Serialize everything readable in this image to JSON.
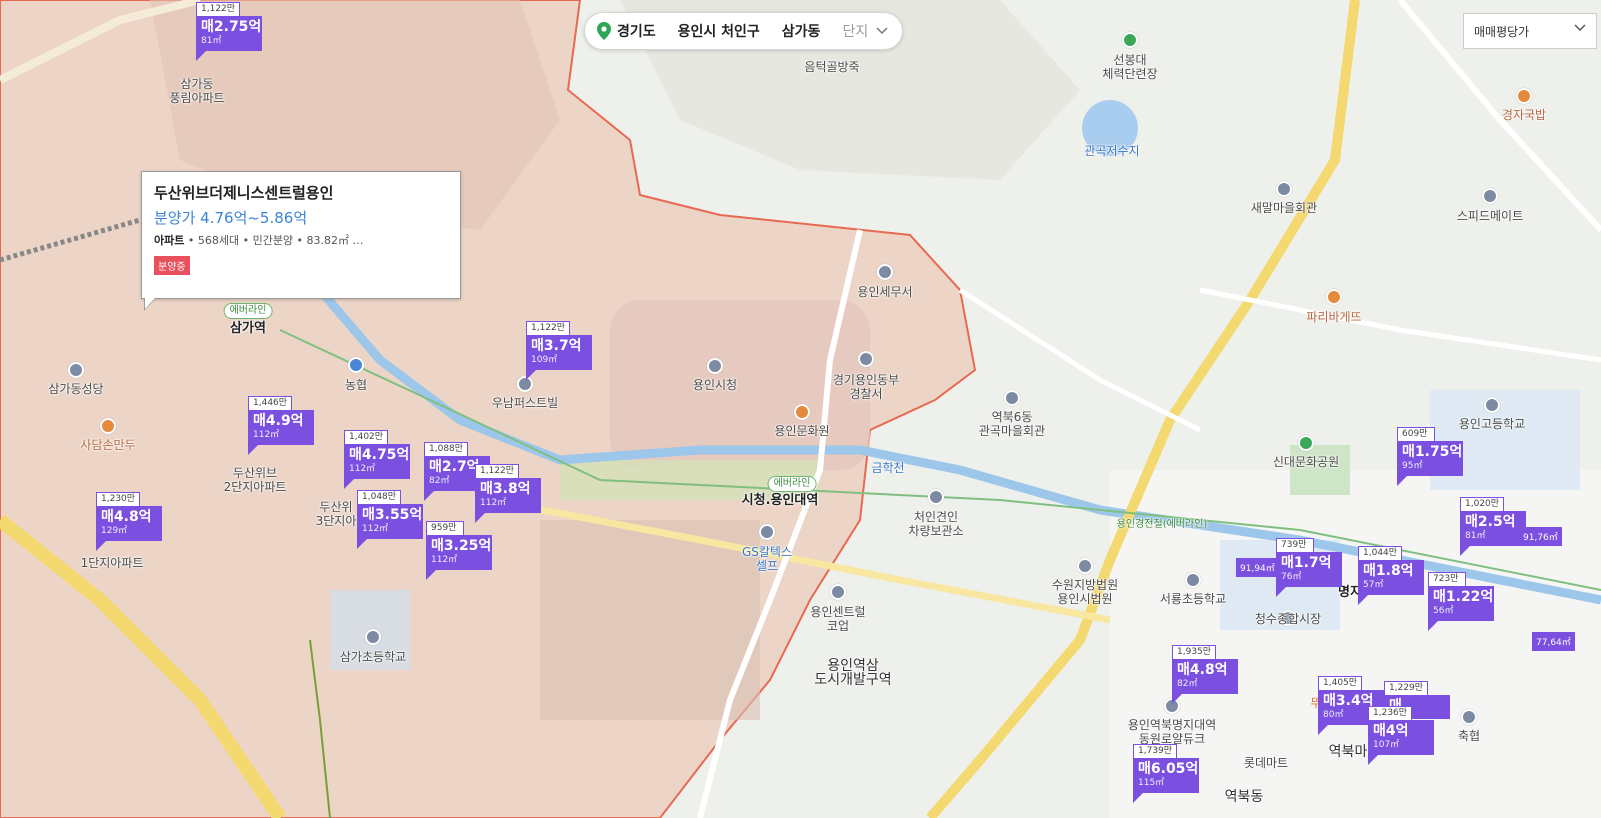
{
  "breadcrumb": {
    "province": "경기도",
    "city": "용인시 처인구",
    "dong": "삼가동",
    "complex_placeholder": "단지"
  },
  "price_type": {
    "selected": "매매평당가"
  },
  "popup": {
    "name": "두산위브더제니스센트럴용인",
    "price": "분양가 4.76억~5.86억",
    "type": "아파트",
    "details": "• 568세대 • 민간분양 • 83.82㎡ …",
    "badge": "분양중"
  },
  "markers": [
    {
      "unit": "1,122만",
      "price": "매2.75억",
      "area": "81㎡"
    },
    {
      "unit": "1,122만",
      "price": "매3.7억",
      "area": "109㎡"
    },
    {
      "unit": "1,446만",
      "price": "매4.9억",
      "area": "112㎡"
    },
    {
      "unit": "1,402만",
      "price": "매4.75억",
      "area": "112㎡"
    },
    {
      "unit": "1,088만",
      "price": "매2.7억",
      "area": "82㎡"
    },
    {
      "unit": "1,122만",
      "price": "매3.8억",
      "area": "112㎡"
    },
    {
      "unit": "1,048만",
      "price": "매3.55억",
      "area": "112㎡"
    },
    {
      "unit": "959만",
      "price": "매3.25억",
      "area": "112㎡"
    },
    {
      "unit": "1,230만",
      "price": "매4.8억",
      "area": "129㎡"
    },
    {
      "unit": "609만",
      "price": "매1.75억",
      "area": "95㎡"
    },
    {
      "unit": "1,020만",
      "price": "매2.5억",
      "area": "81㎡"
    },
    {
      "unit": "739만",
      "price": "매1.7억",
      "area": "76㎡"
    },
    {
      "unit": "1,044만",
      "price": "매1.8억",
      "area": "57㎡"
    },
    {
      "unit": "723만",
      "price": "매1.22억",
      "area": "56㎡"
    },
    {
      "unit": "1,935만",
      "price": "매4.8억",
      "area": "82㎡"
    },
    {
      "unit": "1,405만",
      "price": "매3.4억",
      "area": "80㎡"
    },
    {
      "unit": "1,229만",
      "price": "매",
      "area": ""
    },
    {
      "unit": "1,236만",
      "price": "매4억",
      "area": "107㎡"
    },
    {
      "unit": "1,739만",
      "price": "매6.05억",
      "area": "115㎡"
    }
  ],
  "chips": [
    "91,94㎡",
    "91,76㎡",
    "77,64㎡"
  ],
  "places": {
    "samga_pungrim": "삼가동\n풍림아파트",
    "samga_station": "삼가역",
    "everline": "에버라인",
    "samga_dangdang": "삼가동성당",
    "nonghyup": "농협",
    "sadam": "사담손만두",
    "doosan2": "두산위브\n2단지아파트",
    "doosan3": "두산위\n3단지아",
    "danji1": "1단지아파트",
    "wunam": "우남퍼스트빌",
    "samga_school": "삼가초등학교",
    "yongin_tax": "용인세무서",
    "yongin_cityhall": "용인시청",
    "police": "경기용인동부\n경찰서",
    "culture_park": "용인문화원",
    "cityhall_station": "시청.용인대역",
    "gs": "GS칼텍스\n셀프",
    "geumhak": "금학천",
    "chaeryang": "처인견인\n차량보관소",
    "court": "수원지방법원\n용인시법원",
    "center_court": "용인센트럴\n코업",
    "redevelop": "용인역삼\n도시개발구역",
    "eumteok": "음턱골방죽",
    "seonbong": "선봉대\n체력단련장",
    "gwangok": "관곡저수지",
    "saemal": "새말마을회관",
    "gyeongja": "경자국밥",
    "speedmate": "스피드메이트",
    "paris": "파리바게뜨",
    "yeokbuk6": "역북6동\n관곡마을회관",
    "yongin_hs": "용인고등학교",
    "sinde_park": "신대문화공원",
    "everline_rail": "용인경전철(에버라인)",
    "seosu_school": "서룡초등학교",
    "cheongsu": "청수종합시장",
    "yeokbuk_dongwon": "용인역북명지대역\n동원로얄듀크",
    "lotte": "롯데마트",
    "yeokbuk": "역북동",
    "chukhyeop": "축협",
    "myeongji": "명지",
    "ttu": "뚜",
    "yeokbukma": "역북마"
  }
}
